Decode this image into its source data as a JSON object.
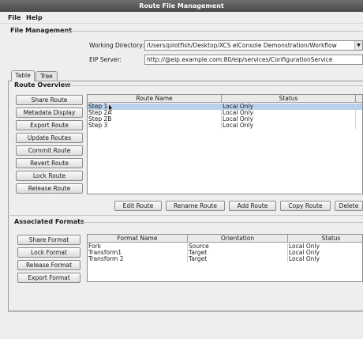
{
  "window": {
    "title": "Route File Management"
  },
  "menu": {
    "file": "File",
    "help": "Help"
  },
  "file_management": {
    "title": "File Management",
    "working_dir_label": "Working Directory:",
    "working_dir_value": "/Users/pilotfish/Desktop/XCS eIConsole Demonstration/Workflow",
    "eip_label": "EIP Server:",
    "eip_value": "http://@eip.example.com:80/eip/services/ConfigurationService"
  },
  "tabs": [
    {
      "label": "Table"
    },
    {
      "label": "Tree"
    }
  ],
  "route_overview": {
    "title": "Route Overview",
    "side_buttons": [
      "Share Route",
      "Metadata Display",
      "Export Route",
      "Update Routes",
      "Commit Route",
      "Revert Route",
      "Lock Route",
      "Release Route"
    ],
    "columns": [
      "Route Name",
      "Status"
    ],
    "rows": [
      {
        "name": "Step 1",
        "status": "Local Only",
        "selected": true
      },
      {
        "name": "Step 2A",
        "status": "Local Only",
        "selected": false
      },
      {
        "name": "Step 2B",
        "status": "Local Only",
        "selected": false
      },
      {
        "name": "Step 3",
        "status": "Local Only",
        "selected": false
      }
    ],
    "bottom_buttons": [
      "Edit Route",
      "Rename Route",
      "Add Route",
      "Copy Route",
      "Delete"
    ]
  },
  "associated_formats": {
    "title": "Associated Formats",
    "side_buttons": [
      "Share Format",
      "Lock Format",
      "Release Format",
      "Export Format"
    ],
    "columns": [
      "Format Name",
      "Orientation",
      "Status"
    ],
    "rows": [
      {
        "name": "Fork",
        "orientation": "Source",
        "status": "Local Only"
      },
      {
        "name": "Transform1",
        "orientation": "Target",
        "status": "Local Only"
      },
      {
        "name": "Transform 2",
        "orientation": "Target",
        "status": "Local Only"
      }
    ]
  },
  "colors": {
    "selection": "#b9d1ea",
    "titlebar": "#5a5a5a",
    "background": "#eeeeee"
  }
}
